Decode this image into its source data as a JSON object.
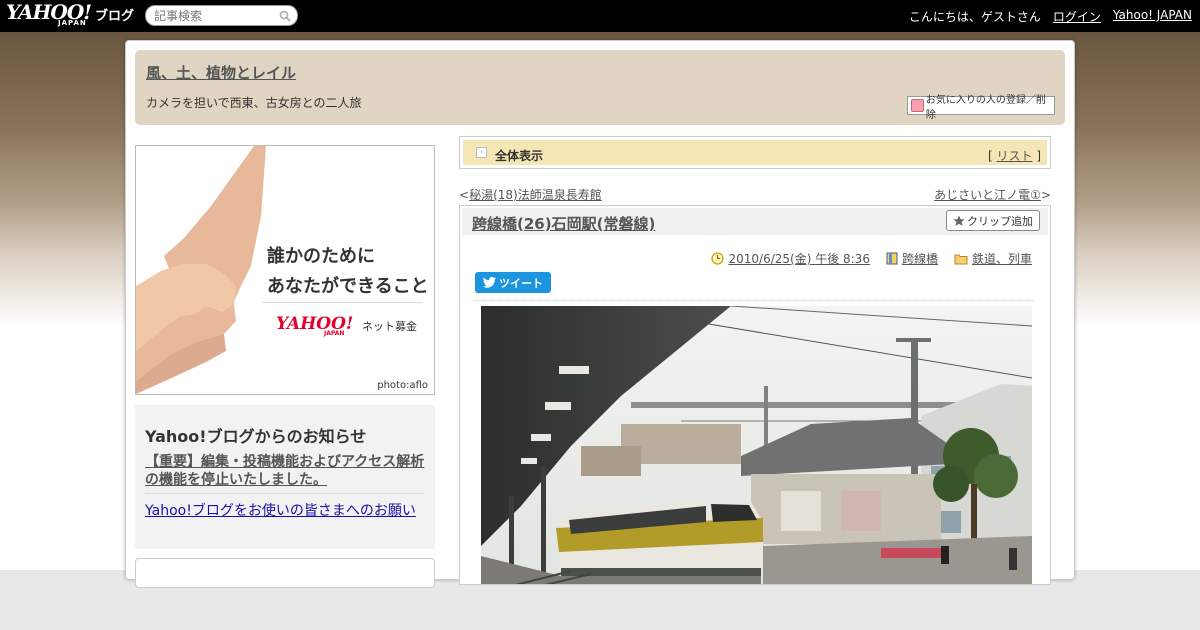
{
  "topbar": {
    "logo_text": "YAHOO!",
    "logo_japan": "JAPAN",
    "logo_blog": "ブログ",
    "search_placeholder": "記事検索",
    "greeting": "こんにちは、ゲストさん",
    "login": "ログイン",
    "yahoo_japan": "Yahoo! JAPAN"
  },
  "header": {
    "blog_title": "風、土、植物とレイル",
    "blog_description": "カメラを担いで西東、古女房との二人旅",
    "favorite_button": "お気に入りの人の登録／削除"
  },
  "ad": {
    "line1": "誰かのために",
    "line2": "あなたができること",
    "brand": "YAHOO!",
    "brand_japan": "JAPAN",
    "brand_sub": "ネット募金",
    "credit": "photo:aflo"
  },
  "notice": {
    "title": "Yahoo!ブログからのお知らせ",
    "link1": "【重要】編集・投稿機能およびアクセス解析の機能を停止いたしました。",
    "link2": "Yahoo!ブログをお使いの皆さまへのお願い"
  },
  "allview": {
    "label": "全体表示",
    "list_open": "[ ",
    "list_link": "リスト",
    "list_close": " ]"
  },
  "navigation": {
    "prev_mark": "<",
    "prev": "秘湯(18)法師温泉長寿館",
    "next": "あじさいと江ノ電①",
    "next_mark": ">"
  },
  "article": {
    "title": "跨線橋(26)石岡駅(常磐線)",
    "clip_button": "クリップ追加",
    "date": "2010/6/25(金) 午後 8:36",
    "tag": "跨線橋",
    "category": "鉄道、列車",
    "tweet": "ツイート"
  },
  "colors": {
    "header_bg": "#e0d5c3",
    "allview_bg": "#f5e7b5",
    "tweet_blue": "#1b95e0",
    "ad_red": "#e6002d"
  }
}
